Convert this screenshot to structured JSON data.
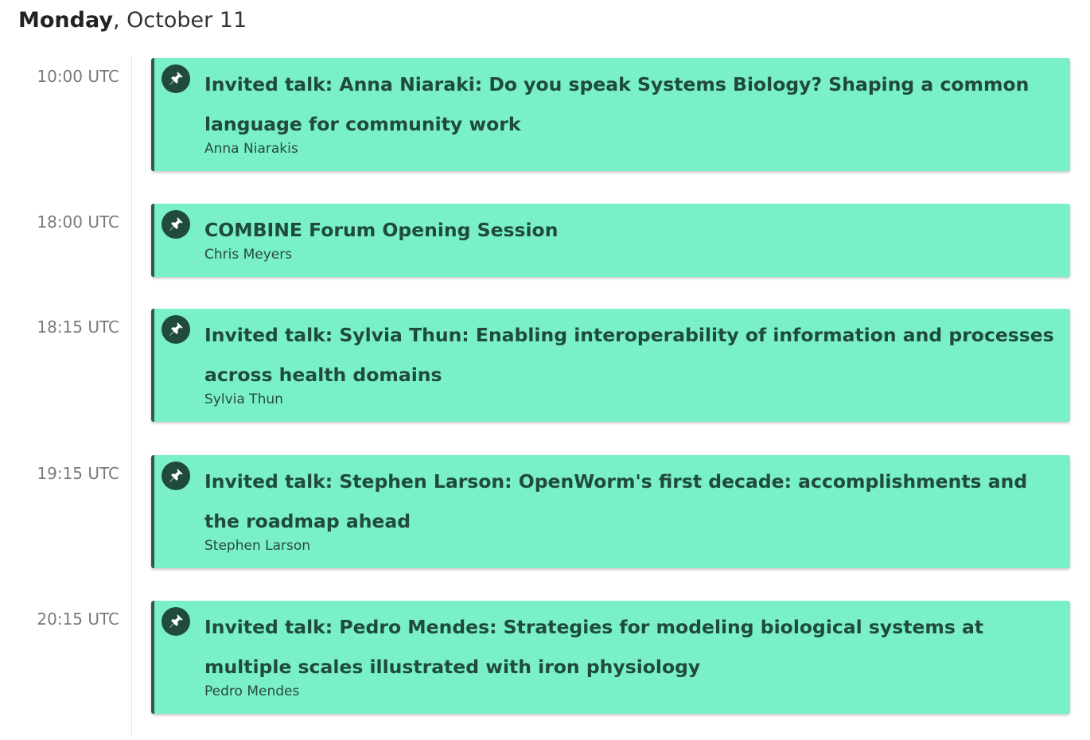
{
  "day": {
    "weekday": "Monday",
    "separator": ",",
    "date": "October 11"
  },
  "events": [
    {
      "time": "10:00 UTC",
      "title": "Invited talk: Anna Niaraki: Do you speak Systems Biology? Shaping a common language for community work",
      "speaker": "Anna Niarakis",
      "icon": "pin-icon"
    },
    {
      "time": "18:00 UTC",
      "title": "COMBINE Forum Opening Session",
      "speaker": "Chris Meyers",
      "icon": "pin-icon"
    },
    {
      "time": "18:15 UTC",
      "title": "Invited talk: Sylvia Thun: Enabling interoperability of information and processes across health domains",
      "speaker": "Sylvia Thun",
      "icon": "pin-icon"
    },
    {
      "time": "19:15 UTC",
      "title": "Invited talk: Stephen Larson: OpenWorm's first decade: accomplishments and the roadmap ahead",
      "speaker": "Stephen Larson",
      "icon": "pin-icon"
    },
    {
      "time": "20:15 UTC",
      "title": "Invited talk: Pedro Mendes: Strategies for modeling biological systems at multiple scales illustrated with iron physiology",
      "speaker": "Pedro Mendes",
      "icon": "pin-icon"
    }
  ],
  "colors": {
    "card_background": "#79f0c5",
    "card_accent": "#2b5a48",
    "title_text": "#1f4a3c",
    "time_text": "#7a7a7a"
  }
}
